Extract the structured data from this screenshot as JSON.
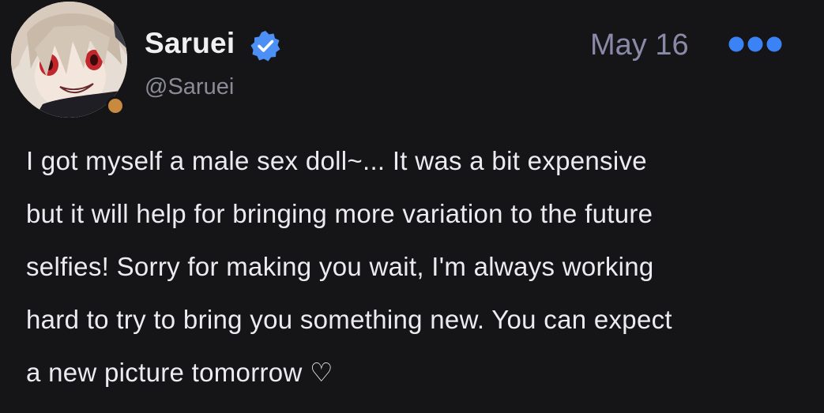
{
  "author": {
    "display_name": "Saruei",
    "handle": "@Saruei",
    "verified_icon": "verified-badge-icon",
    "status_color": "#c98a3f"
  },
  "post": {
    "date": "May 16",
    "lines": [
      "I got myself a male sex doll~... It was a bit expensive",
      "but it will help for bringing more variation to the future",
      "selfies! Sorry for making you wait, I'm always working",
      "hard to try to bring you something new. You can expect",
      "a new picture tomorrow ♡"
    ]
  },
  "menu": {
    "icon": "more-options-icon",
    "color": "#3b82f6"
  }
}
